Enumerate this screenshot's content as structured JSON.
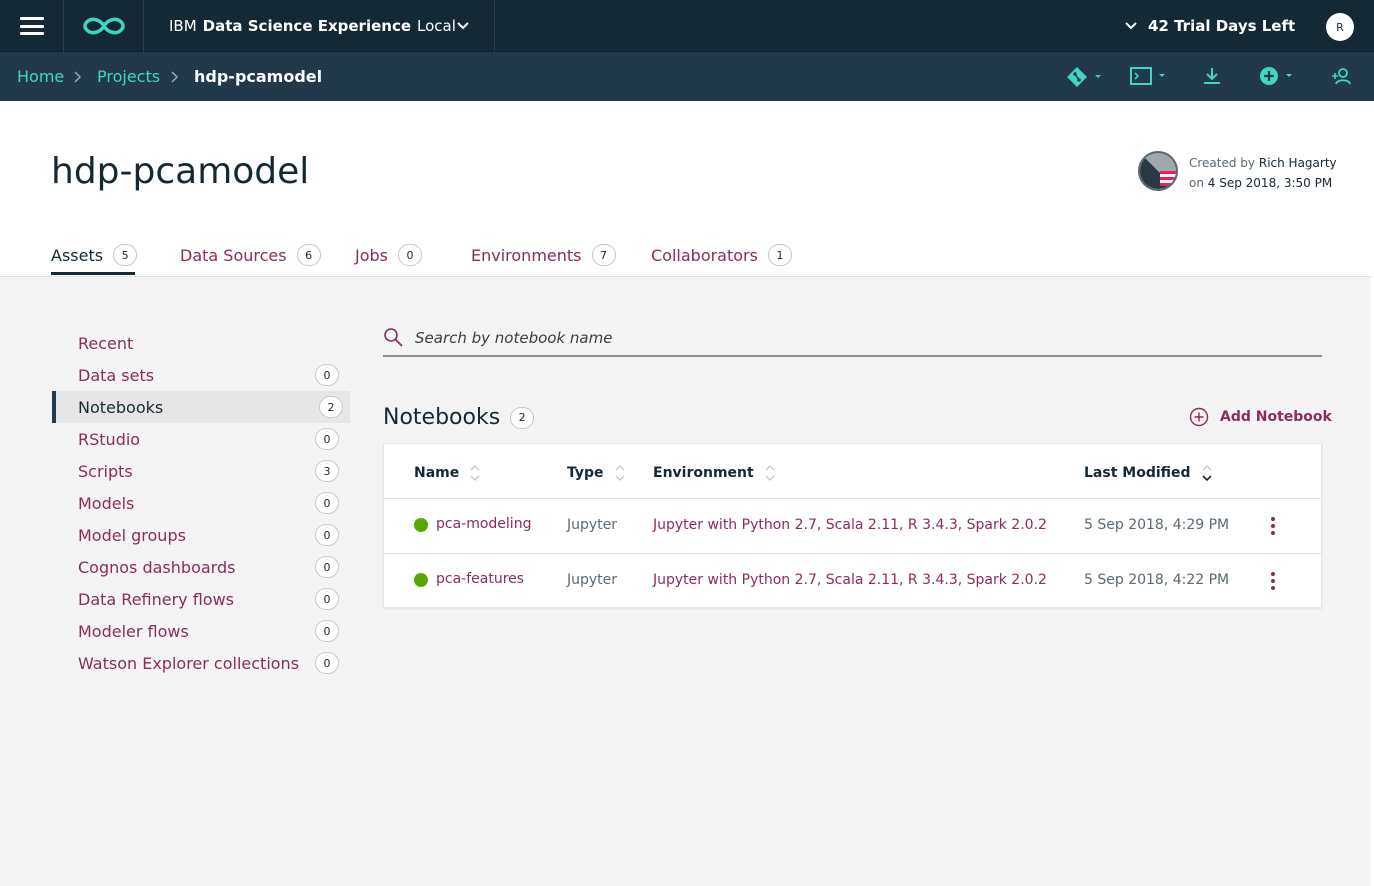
{
  "topbar": {
    "product_ibm": "IBM",
    "product_name": "Data Science Experience",
    "product_edition": "Local",
    "trial_text": "42 Trial Days Left",
    "user_initial": "R"
  },
  "breadcrumb": {
    "home": "Home",
    "projects": "Projects",
    "current": "hdp-pcamodel"
  },
  "project": {
    "title": "hdp-pcamodel",
    "created_by_label": "Created by",
    "created_by": "Rich Hagarty",
    "created_on_label": "on",
    "created_on": "4 Sep 2018, 3:50 PM"
  },
  "tabs": [
    {
      "label": "Assets",
      "count": "5"
    },
    {
      "label": "Data Sources",
      "count": "6"
    },
    {
      "label": "Jobs",
      "count": "0"
    },
    {
      "label": "Environments",
      "count": "7"
    },
    {
      "label": "Collaborators",
      "count": "1"
    }
  ],
  "sidebar": {
    "items": [
      {
        "label": "Recent",
        "count": ""
      },
      {
        "label": "Data sets",
        "count": "0"
      },
      {
        "label": "Notebooks",
        "count": "2"
      },
      {
        "label": "RStudio",
        "count": "0"
      },
      {
        "label": "Scripts",
        "count": "3"
      },
      {
        "label": "Models",
        "count": "0"
      },
      {
        "label": "Model groups",
        "count": "0"
      },
      {
        "label": "Cognos dashboards",
        "count": "0"
      },
      {
        "label": "Data Refinery flows",
        "count": "0"
      },
      {
        "label": "Modeler flows",
        "count": "0"
      },
      {
        "label": "Watson Explorer collections",
        "count": "0"
      }
    ]
  },
  "search": {
    "placeholder": "Search by notebook name",
    "value": ""
  },
  "notebooks": {
    "heading": "Notebooks",
    "count": "2",
    "add_label": "Add Notebook",
    "columns": {
      "name": "Name",
      "type": "Type",
      "environment": "Environment",
      "last_modified": "Last Modified"
    },
    "rows": [
      {
        "name": "pca-modeling",
        "type": "Jupyter",
        "environment": "Jupyter with Python 2.7, Scala 2.11, R 3.4.3, Spark 2.0.2",
        "last_modified": "5 Sep 2018, 4:29 PM",
        "status_color": "#5aa700"
      },
      {
        "name": "pca-features",
        "type": "Jupyter",
        "environment": "Jupyter with Python 2.7, Scala 2.11, R 3.4.3, Spark 2.0.2",
        "last_modified": "5 Sep 2018, 4:22 PM",
        "status_color": "#5aa700"
      }
    ]
  },
  "colors": {
    "topbar_bg": "#152935",
    "subbar_bg": "#22394a",
    "accent_teal": "#41d6c3",
    "link_magenta": "#8c2b5e",
    "status_green": "#5aa700"
  },
  "icons": {
    "menu": "hamburger-icon",
    "logo": "infinity-logo-icon",
    "git": "git-icon",
    "terminal": "terminal-icon",
    "download": "download-icon",
    "add": "add-circle-icon",
    "add_user": "add-collaborator-icon",
    "search": "search-icon",
    "overflow": "kebab-menu-icon"
  }
}
